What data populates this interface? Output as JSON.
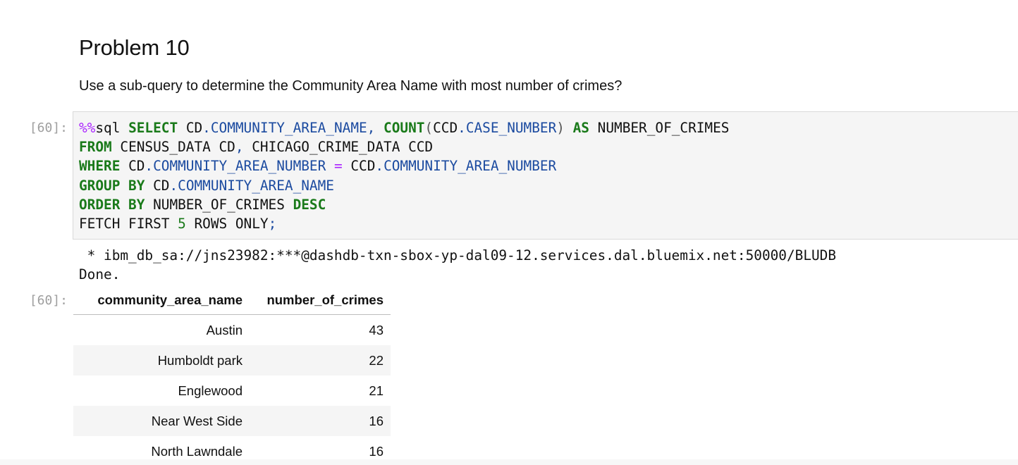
{
  "markdown": {
    "heading": "Problem 10",
    "text": "Use a sub-query to determine the Community Area Name with most number of crimes?"
  },
  "code_cell": {
    "prompt": "[60]:",
    "tokens": {
      "magic": "%%",
      "magic_name": "sql",
      "select": "SELECT",
      "from": "FROM",
      "where": "WHERE",
      "group_by": "GROUP BY",
      "order_by": "ORDER BY",
      "desc": "DESC",
      "count": "COUNT",
      "as": "AS",
      "cd": "CD",
      "ccd": "CCD",
      "community_area_name": "COMMUNITY_AREA_NAME",
      "community_area_number": "COMMUNITY_AREA_NUMBER",
      "case_number": "CASE_NUMBER",
      "number_of_crimes": "NUMBER_OF_CRIMES",
      "census_table": "CENSUS_DATA",
      "crime_table": "CHICAGO_CRIME_DATA",
      "fetch_first": "FETCH FIRST",
      "limit": "5",
      "rows_only": "ROWS ONLY",
      "semicolon": ";"
    }
  },
  "output": {
    "stream_lines": [
      " * ibm_db_sa://jns23982:***@dashdb-txn-sbox-yp-dal09-12.services.dal.bluemix.net:50000/BLUDB",
      "Done."
    ],
    "prompt": "[60]:",
    "table": {
      "columns": [
        "community_area_name",
        "number_of_crimes"
      ],
      "rows": [
        [
          "Austin",
          "43"
        ],
        [
          "Humboldt park",
          "22"
        ],
        [
          "Englewood",
          "21"
        ],
        [
          "Near West Side",
          "16"
        ],
        [
          "North Lawndale",
          "16"
        ]
      ]
    }
  },
  "colors": {
    "keyword": "#1a7a1a",
    "magic": "#aa22ff",
    "attribute": "#1c4ba0",
    "prompt": "#9e9e9e",
    "cell_background": "#f5f5f5"
  }
}
